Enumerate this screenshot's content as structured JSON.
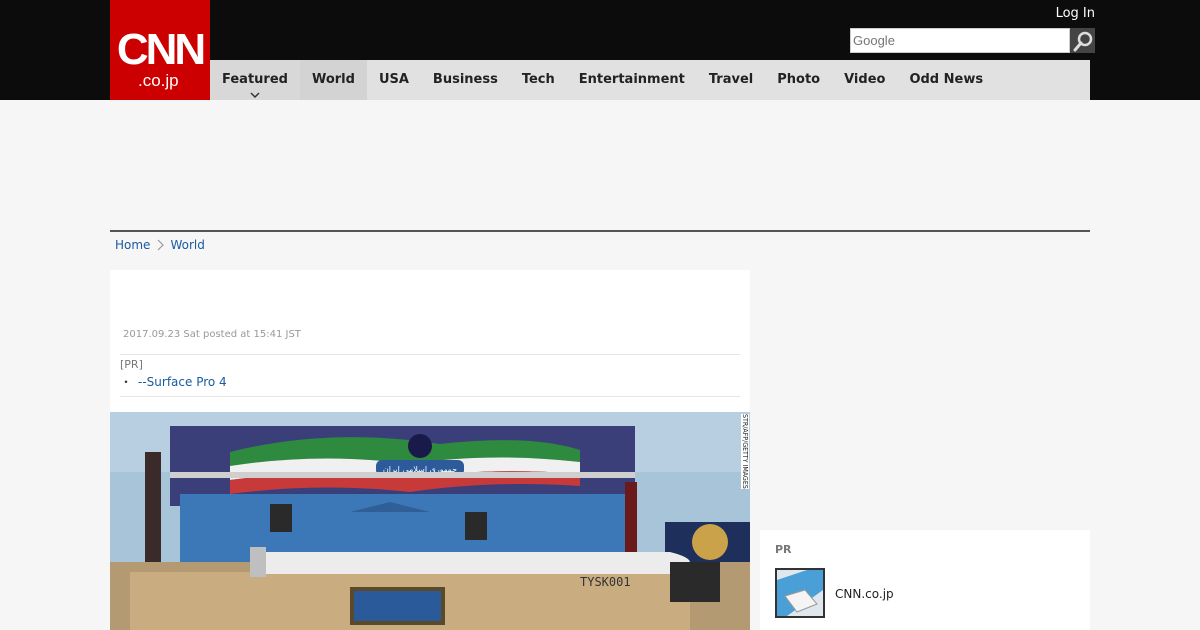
{
  "header": {
    "logo_main": "CNN",
    "logo_sub": ".co.jp",
    "login_label": "Log In",
    "search_placeholder": "Google"
  },
  "nav": {
    "items": [
      {
        "label": "Featured"
      },
      {
        "label": "World"
      },
      {
        "label": "USA"
      },
      {
        "label": "Business"
      },
      {
        "label": "Tech"
      },
      {
        "label": "Entertainment"
      },
      {
        "label": "Travel"
      },
      {
        "label": "Photo"
      },
      {
        "label": "Video"
      },
      {
        "label": "Odd News"
      }
    ]
  },
  "breadcrumb": {
    "home": "Home",
    "section": "World"
  },
  "article": {
    "posted": "2017.09.23 Sat posted at 15:41 JST",
    "pr_label": "[PR]",
    "pr_link": "--Surface Pro 4",
    "photo_credit": "STR/AFP/GETTY IMAGES",
    "photo_banner_text": "جمهوری اسلامی ایران",
    "missile_marking": "TYSK001"
  },
  "sidebar": {
    "pr_label": "PR",
    "pr_item_name": "CNN.co.jp"
  },
  "colors": {
    "brand_red": "#cc0000",
    "link_blue": "#1a5aa0",
    "header_bg": "#0c0c0c",
    "nav_bg": "#e1e1e1"
  }
}
